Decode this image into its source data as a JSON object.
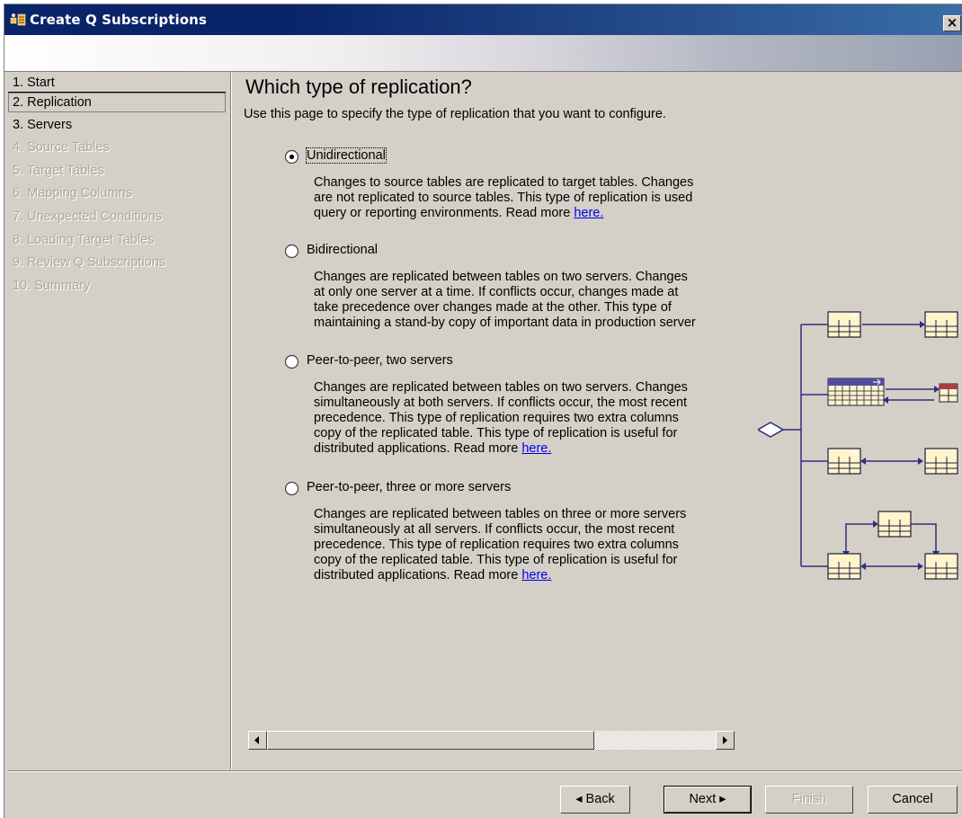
{
  "window": {
    "title": "Create Q Subscriptions",
    "close_label": "×",
    "icon": "wizard-app-icon"
  },
  "nav": {
    "items": [
      {
        "label": "1. Start",
        "enabled": true,
        "selected": false
      },
      {
        "label": "2. Replication",
        "enabled": true,
        "selected": true
      },
      {
        "label": "3. Servers",
        "enabled": true,
        "selected": false
      },
      {
        "label": "4. Source Tables",
        "enabled": false,
        "selected": false
      },
      {
        "label": "5. Target Tables",
        "enabled": false,
        "selected": false
      },
      {
        "label": "6. Mapping Columns",
        "enabled": false,
        "selected": false
      },
      {
        "label": "7. Unexpected Conditions",
        "enabled": false,
        "selected": false
      },
      {
        "label": "8. Loading Target Tables",
        "enabled": false,
        "selected": false
      },
      {
        "label": "9. Review Q Subscriptions",
        "enabled": false,
        "selected": false
      },
      {
        "label": "10. Summary",
        "enabled": false,
        "selected": false
      }
    ]
  },
  "page": {
    "title": "Which type of replication?",
    "description": "Use this page to specify the type of replication that you want to configure."
  },
  "options": [
    {
      "label": "Unidirectional",
      "selected": true,
      "lines": [
        "Changes to source tables are replicated to target tables. Changes",
        "are not replicated to source tables. This type of replication is used",
        "query or reporting environments. Read more "
      ],
      "link": "here."
    },
    {
      "label": "Bidirectional",
      "selected": false,
      "lines": [
        "Changes are replicated between tables on two servers. Changes",
        "at only one server at a time. If conflicts occur, changes made at",
        "take precedence over changes made at the other. This type of",
        "maintaining a stand-by copy of important data in production server"
      ],
      "link": ""
    },
    {
      "label": "Peer-to-peer, two servers",
      "selected": false,
      "lines": [
        "Changes are replicated between tables on two servers. Changes",
        "simultaneously at both servers. If conflicts occur, the most recent",
        "precedence. This type of replication requires two extra columns",
        "copy of the replicated table. This type of replication is useful for",
        "distributed applications. Read more "
      ],
      "link": "here."
    },
    {
      "label": "Peer-to-peer, three or more servers",
      "selected": false,
      "lines": [
        "Changes are replicated between tables on three or more servers",
        "simultaneously at all servers. If conflicts occur, the most recent",
        "precedence. This type of replication requires two extra columns",
        "copy of the replicated table. This type of replication is useful for",
        "distributed applications. Read more "
      ],
      "link": "here."
    }
  ],
  "buttons": {
    "back": "◂ Back",
    "next": "Next ▸",
    "finish": "Finish",
    "cancel": "Cancel"
  },
  "colors": {
    "source_table": "#4f4f9e",
    "target_table": "#a83b46",
    "peer_table": "#6b2c4e",
    "table_body": "#fff4cc",
    "connector": "#2e2e7a"
  }
}
